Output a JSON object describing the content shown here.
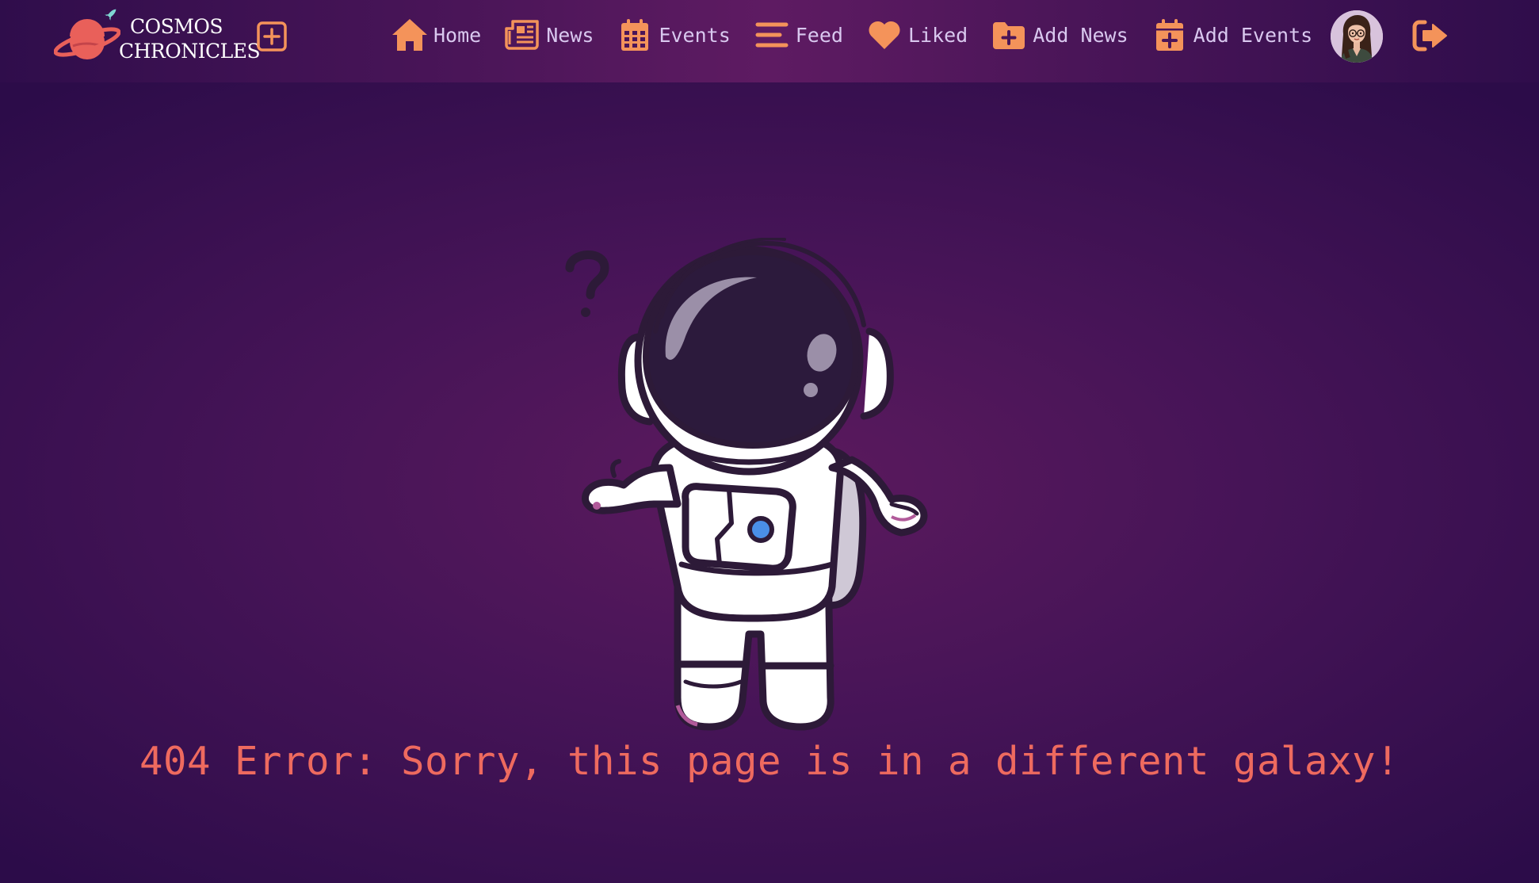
{
  "brand": {
    "line1": "Cosmos",
    "line2": "Chronicles",
    "icon": "planet-rocket-logo"
  },
  "toolbar": {
    "add_icon": "plus-square-icon"
  },
  "nav": {
    "items": [
      {
        "label": "Home",
        "icon": "home-icon"
      },
      {
        "label": "News",
        "icon": "newspaper-icon"
      },
      {
        "label": "Events",
        "icon": "calendar-icon"
      },
      {
        "label": "Feed",
        "icon": "menu-lines-icon"
      },
      {
        "label": "Liked",
        "icon": "heart-icon"
      },
      {
        "label": "Add News",
        "icon": "folder-plus-icon"
      },
      {
        "label": "Add Events",
        "icon": "calendar-plus-icon"
      }
    ]
  },
  "user": {
    "avatar": "user-avatar",
    "logout_icon": "logout-icon"
  },
  "error": {
    "message": "404 Error: Sorry, this page is in a different galaxy!",
    "illustration": "confused-astronaut"
  },
  "colors": {
    "accent": "#f4935a",
    "nav_text": "#d9c8ef",
    "error_text": "#ee6a5f",
    "background": "#461457"
  }
}
